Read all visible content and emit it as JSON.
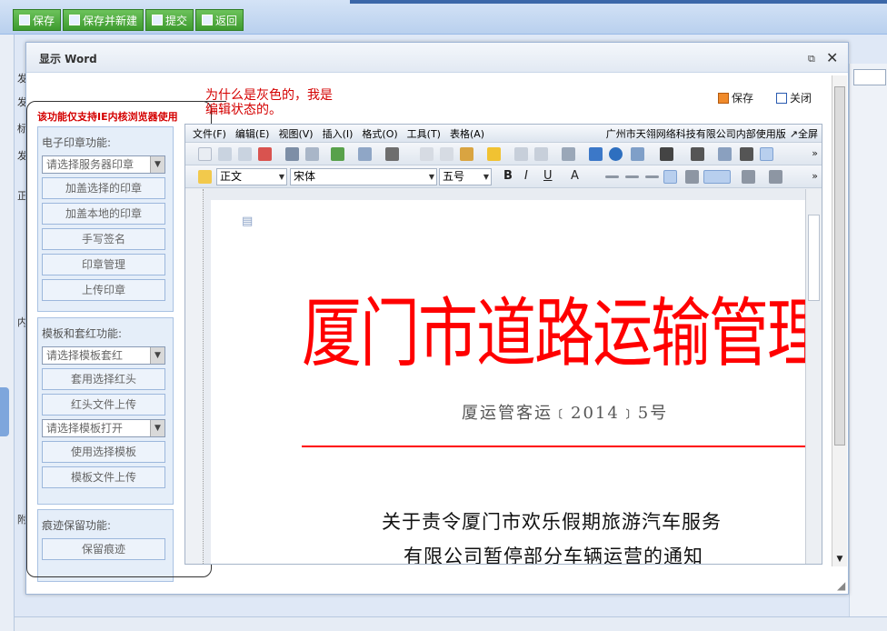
{
  "toolbar": {
    "buttons": [
      "保存",
      "保存并新建",
      "提交",
      "返回"
    ]
  },
  "background": {
    "side_labels": [
      "发",
      "发",
      "标",
      "发",
      "正",
      "内",
      "附"
    ]
  },
  "dialog": {
    "title": "显示 Word",
    "left_panel": {
      "note": "该功能仅支持IE内核浏览器使用",
      "seal_group": {
        "title": "电子印章功能:",
        "select": "请选择服务器印章",
        "buttons": [
          "加盖选择的印章",
          "加盖本地的印章",
          "手写签名",
          "印章管理",
          "上传印章"
        ]
      },
      "template_group": {
        "title": "模板和套红功能:",
        "select1": "请选择模板套红",
        "buttons1": [
          "套用选择红头",
          "红头文件上传"
        ],
        "select2": "请选择模板打开",
        "buttons2": [
          "使用选择模板",
          "模板文件上传"
        ]
      },
      "trace_group": {
        "title": "痕迹保留功能:",
        "buttons": [
          "保留痕迹"
        ]
      }
    },
    "annotation": "为什么是灰色的，我是编辑状态的。",
    "actions": {
      "save": "保存",
      "close": "关闭"
    },
    "word": {
      "menus": [
        "文件(F)",
        "编辑(E)",
        "视图(V)",
        "插入(I)",
        "格式(O)",
        "工具(T)",
        "表格(A)"
      ],
      "company": "广州市天翎网络科技有限公司内部使用版",
      "fullscreen": "↗全屏",
      "style": "正文",
      "font": "宋体",
      "size": "五号",
      "document": {
        "red_header": "厦门市道路运输管理处文件",
        "doc_number": "厦运管客运﹝2014﹞5号",
        "title_line1": "关于责令厦门市欢乐假期旅游汽车服务",
        "title_line2": "有限公司暂停部分车辆运营的通知"
      }
    }
  },
  "colors": {
    "red_header": "#ff0000",
    "note": "#d40000",
    "toolbar_green": "#3e9b2f"
  }
}
